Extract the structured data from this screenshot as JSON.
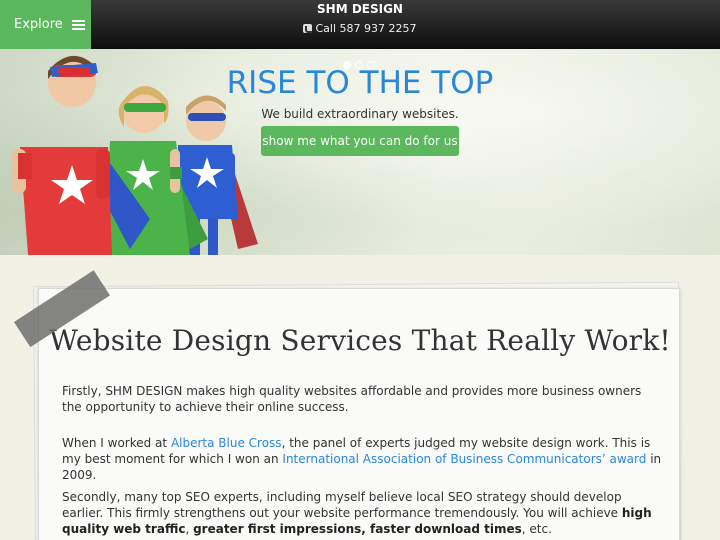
{
  "header": {
    "explore_label": "Explore",
    "brand": "SHM DESIGN",
    "phone": "Call 587 937 2257"
  },
  "hero": {
    "title": "RISE TO THE TOP",
    "subtitle": "We build extraordinary websites.",
    "cta_label": "show me what you can do for us",
    "slides": 3,
    "active_slide": 1
  },
  "content": {
    "title": "Website Design Services That Really Work!",
    "p1": "Firstly, SHM DESIGN makes high quality websites affordable and provides more business owners the opportunity to achieve their online success.",
    "p2_a": "When I worked at ",
    "p2_link1": "Alberta Blue Cross",
    "p2_b": ", the panel of experts judged my website design work. This is my best moment for which I won an ",
    "p2_link2": "International Association of Business Communicators’ award",
    "p2_c": " in 2009.",
    "p3_a": " Secondly, many top SEO experts, including myself believe local SEO strategy should develop earlier. This firmly strengthens out your website performance tremendously. You will achieve ",
    "p3_b1": "high quality web traffic",
    "p3_b": ", ",
    "p3_b2": "greater first impressions, faster download times",
    "p3_c": ", etc."
  },
  "colors": {
    "accent_green": "#5cb85c",
    "link_blue": "#2a87d8",
    "header_dark": "#0d0d0d"
  }
}
